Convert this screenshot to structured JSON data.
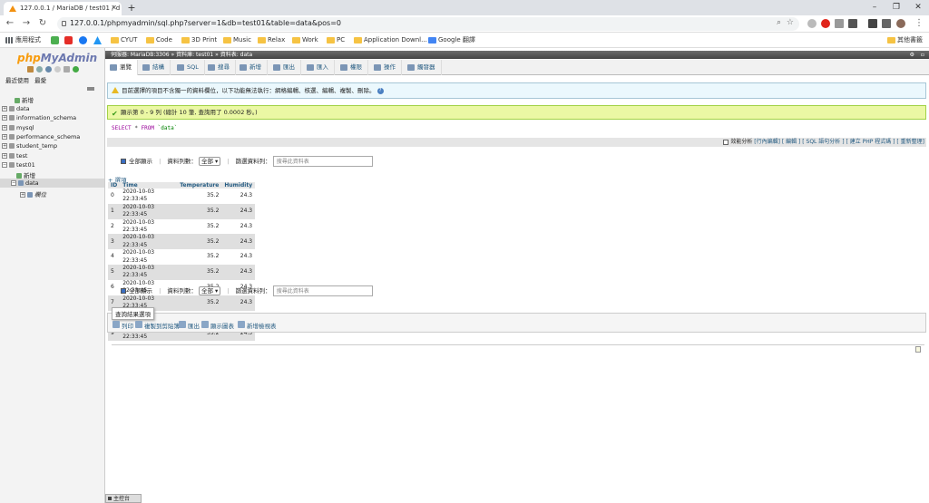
{
  "browser": {
    "tab_title": "127.0.0.1 / MariaDB / test01 / d",
    "url": "127.0.0.1/phpmyadmin/sql.php?server=1&db=test01&table=data&pos=0",
    "bookmarks": [
      "應用程式",
      "CYUT",
      "Code",
      "3D Print",
      "Music",
      "Relax",
      "Work",
      "PC",
      "Application Downl...",
      "Google 翻譯"
    ],
    "other_bookmarks": "其他書籤"
  },
  "sidebar": {
    "logo_php": "php",
    "logo_myadmin": "MyAdmin",
    "recent": "最近使用",
    "favorites": "最愛",
    "items": [
      "新增",
      "data",
      "information_schema",
      "mysql",
      "performance_schema",
      "student_temp",
      "test",
      "test01"
    ],
    "test01_children": [
      "新增",
      "data"
    ],
    "data_children": [
      "欄位"
    ]
  },
  "breadcrumb": {
    "server": "伺服器: MariaDB:3306",
    "db": "資料庫: test01",
    "table": "資料表: data"
  },
  "menu": [
    "瀏覽",
    "結構",
    "SQL",
    "搜尋",
    "新增",
    "匯出",
    "匯入",
    "權限",
    "操作",
    "觸發器"
  ],
  "notice": "目前選擇的項目不含獨一的資料欄位，以下功能無法執行：網格編輯、核選、編輯、複製、刪除。",
  "success": "顯示第 0 - 9 列 (總計 10 筆, 查詢用了 0.0002 秒。)",
  "sql": {
    "select": "SELECT",
    "star": "*",
    "from": "FROM",
    "table": "`data`"
  },
  "profiling": {
    "label": "效能分析",
    "links": "[行內編輯] [ 編輯 ] [ SQL 語句分析 ] [ 建立 PHP 程式碼 ] [ 重新整理]"
  },
  "controls": {
    "show_all": "全部顯示",
    "rows_label": "資料列數：",
    "rows_value": "全部",
    "filter_label": "篩選資料列：",
    "filter_placeholder": "搜尋此資料表"
  },
  "options_link": "+ 選項",
  "table": {
    "columns": [
      "ID",
      "Time",
      "Temperature",
      "Humidity"
    ],
    "rows": [
      [
        "0",
        "2020-10-03 22:33:45",
        "35.2",
        "24.3"
      ],
      [
        "1",
        "2020-10-03 22:33:45",
        "35.2",
        "24.3"
      ],
      [
        "2",
        "2020-10-03 22:33:45",
        "35.2",
        "24.3"
      ],
      [
        "3",
        "2020-10-03 22:33:45",
        "35.2",
        "24.3"
      ],
      [
        "4",
        "2020-10-03 22:33:45",
        "35.2",
        "24.3"
      ],
      [
        "5",
        "2020-10-03 22:33:45",
        "35.2",
        "24.3"
      ],
      [
        "6",
        "2020-10-03 22:33:45",
        "35.2",
        "24.3"
      ],
      [
        "7",
        "2020-10-03 22:33:45",
        "35.2",
        "24.3"
      ],
      [
        "8",
        "2020-10-03 22:33:45",
        "35.2",
        "24.3"
      ],
      [
        "9",
        "2020-10-03 22:33:45",
        "35.2",
        "24.3"
      ]
    ]
  },
  "query_ops": {
    "title": "查詢結果選項",
    "items": [
      "列印",
      "複製到剪貼簿",
      "匯出",
      "顯示圖表",
      "新增檢視表"
    ]
  },
  "console": "主控台"
}
